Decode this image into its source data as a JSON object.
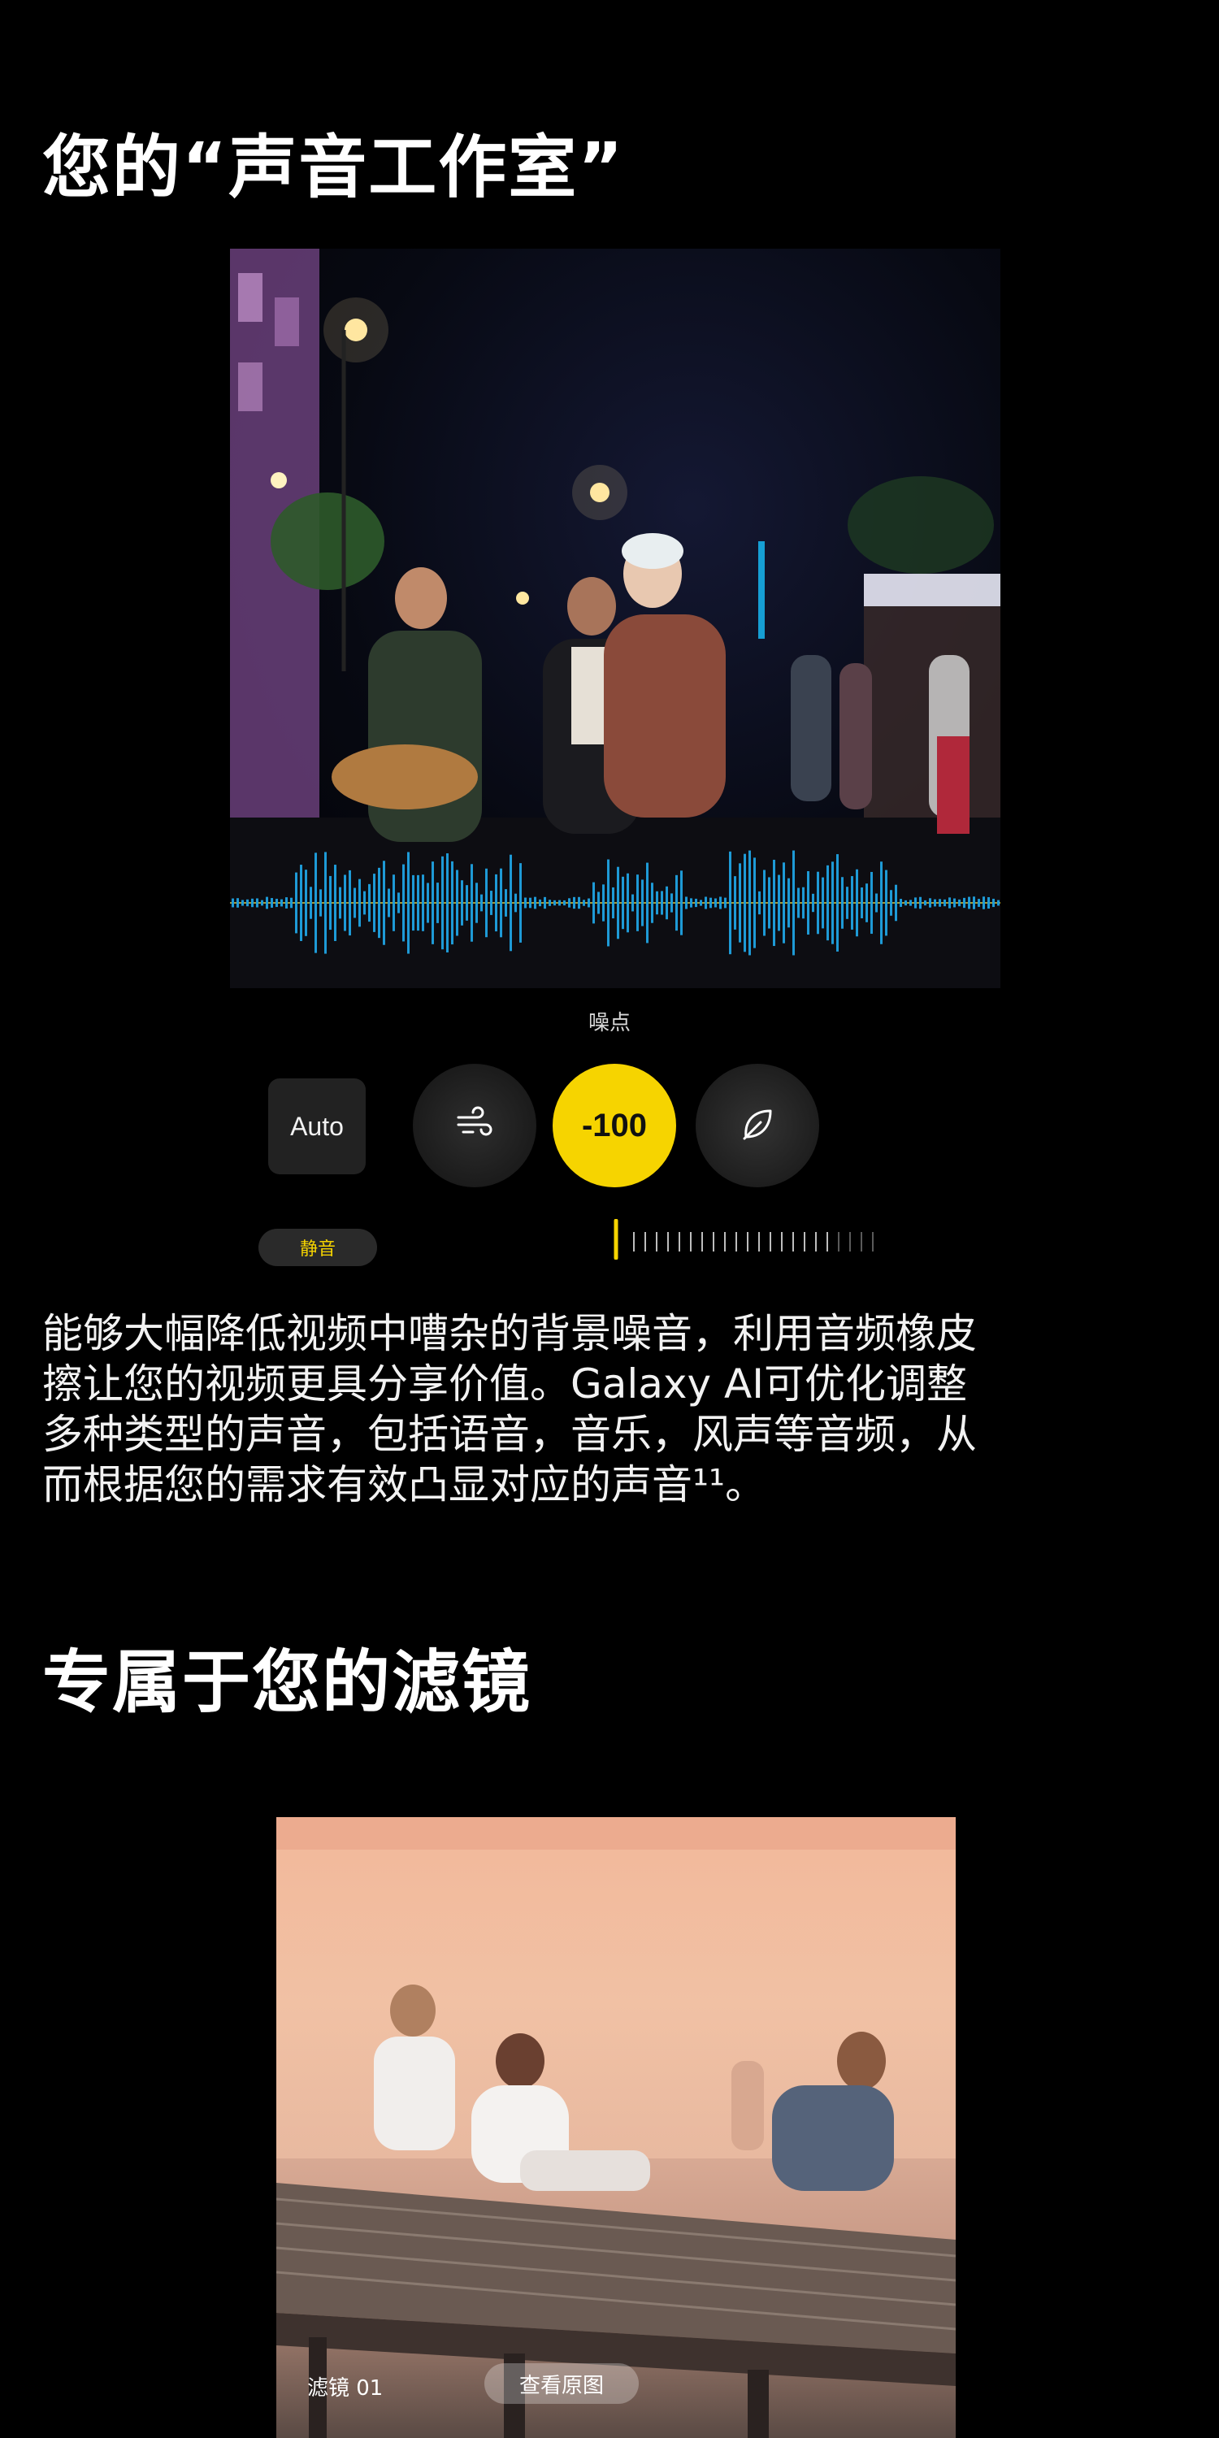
{
  "section1": {
    "title": "您的“声音工作室”",
    "noise_label": "噪点",
    "controls": {
      "auto_label": "Auto",
      "value_label": "-100",
      "mute_label": "静音",
      "wind_icon": "wind-icon",
      "leaf_icon": "leaf-icon"
    },
    "description": [
      "能够大幅降低视频中嘈杂的背景噪音，利用音频橡皮",
      "擦让您的视频更具分享价值。Galaxy AI可优化调整",
      "多种类型的声音，包括语音，音乐，风声等音频，从",
      "而根据您的需求有效凸显对应的声音¹¹。"
    ]
  },
  "section2": {
    "title": "专属于您的滤镜",
    "filter_label": "滤镜 01",
    "view_original_label": "查看原图"
  },
  "colors": {
    "accent": "#f6d400",
    "background": "#000000",
    "waveform": "#1e9ad6"
  }
}
